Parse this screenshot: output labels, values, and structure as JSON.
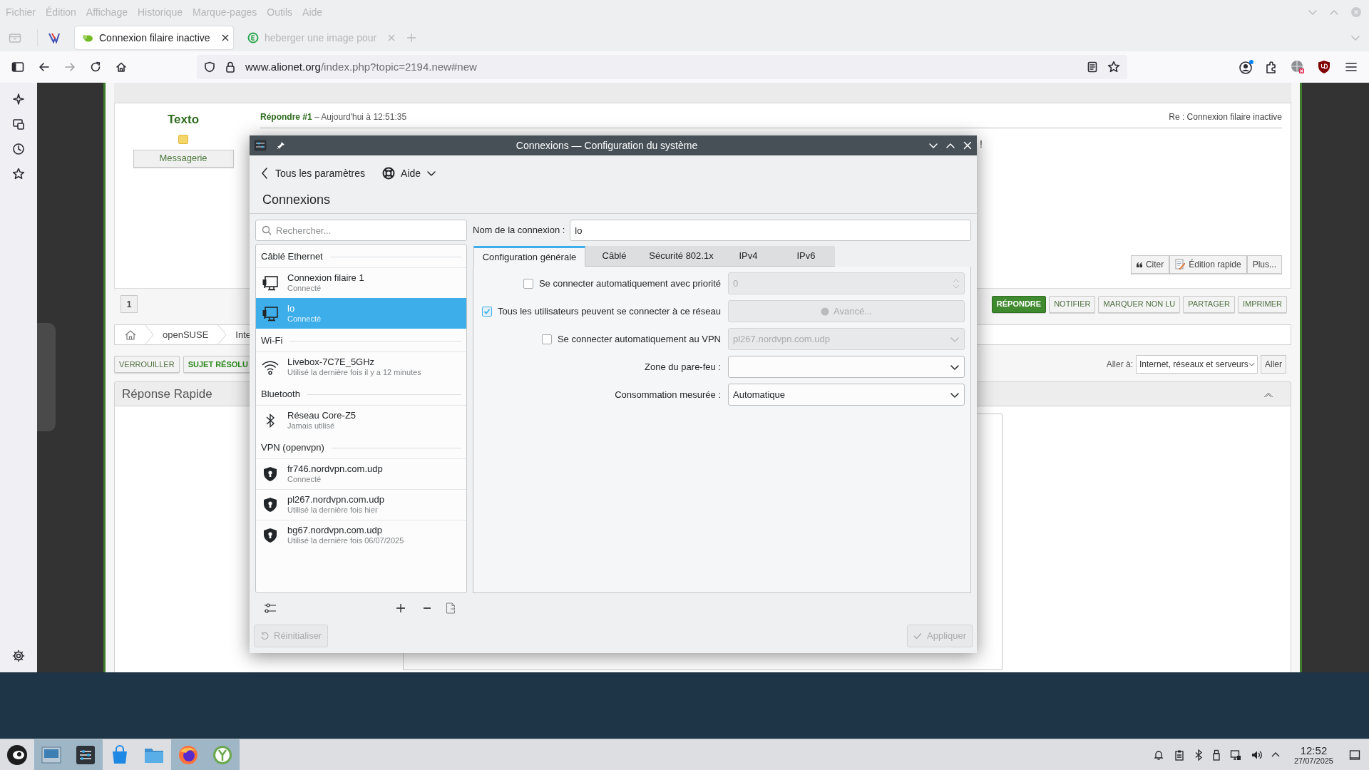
{
  "browser": {
    "menu": [
      "Fichier",
      "Édition",
      "Affichage",
      "Historique",
      "Marque-pages",
      "Outils",
      "Aide"
    ],
    "tabs": [
      {
        "label": "Connexion filaire inactive",
        "selected": true
      },
      {
        "label": "heberger une image pour",
        "selected": false
      }
    ],
    "address": {
      "host": "www.alionet.org",
      "path": "/index.php?topic=2194.new#new"
    }
  },
  "forum": {
    "post": {
      "author": "Texto",
      "messaging_button": "Messagerie",
      "reply_ref": "Répondre #1",
      "time": "– Aujourd'hui à 12:51:35",
      "subject": "Re : Connexion filaire inactive",
      "body": "!",
      "actions": [
        "Citer",
        "Édition rapide",
        "Plus..."
      ]
    },
    "page": "1",
    "topic_buttons": [
      {
        "label": "RÉPONDRE",
        "kind": "primary"
      },
      {
        "label": "NOTIFIER",
        "kind": "default"
      },
      {
        "label": "MARQUER NON LU",
        "kind": "default"
      },
      {
        "label": "PARTAGER",
        "kind": "default"
      },
      {
        "label": "IMPRIMER",
        "kind": "default"
      }
    ],
    "breadcrumb": [
      "openSUSE",
      "Inte"
    ],
    "mod_buttons": [
      {
        "label": "VERROUILLER",
        "kind": "default"
      },
      {
        "label": "SUJET RÉSOLU",
        "kind": "primary"
      }
    ],
    "jump": {
      "label": "Aller à:",
      "value": "Internet, réseaux et serveurs",
      "button": "Aller"
    },
    "quick_reply": {
      "title": "Réponse Rapide"
    }
  },
  "dialog": {
    "title": "Connexions — Configuration du système",
    "back": "Tous les paramètres",
    "help": "Aide",
    "heading": "Connexions",
    "search": {
      "placeholder": "Rechercher..."
    },
    "groups": [
      {
        "title": "Câblé Ethernet",
        "connections": [
          {
            "kind": "ethernet",
            "name": "Connexion filaire 1",
            "status": "Connecté",
            "selected": false
          },
          {
            "kind": "ethernet",
            "name": "lo",
            "status": "Connecté",
            "selected": true
          }
        ]
      },
      {
        "title": "Wi-Fi",
        "connections": [
          {
            "kind": "wifi",
            "name": "Livebox-7C7E_5GHz",
            "status": "Utilisé la dernière fois il y a 12 minutes",
            "selected": false
          }
        ]
      },
      {
        "title": "Bluetooth",
        "connections": [
          {
            "kind": "bluetooth",
            "name": "Réseau Core-Z5",
            "status": "Jamais utilisé",
            "selected": false
          }
        ]
      },
      {
        "title": "VPN (openvpn)",
        "connections": [
          {
            "kind": "vpn",
            "name": "fr746.nordvpn.com.udp",
            "status": "Connecté",
            "selected": false
          },
          {
            "kind": "vpn",
            "name": "pl267.nordvpn.com.udp",
            "status": "Utilisé la dernière fois hier",
            "selected": false
          },
          {
            "kind": "vpn",
            "name": "bg67.nordvpn.com.udp",
            "status": "Utilisé la dernière fois 06/07/2025",
            "selected": false
          }
        ]
      }
    ],
    "name_label": "Nom de la connexion :",
    "name_value": "lo",
    "tabs": [
      {
        "label": "Configuration générale",
        "selected": true
      },
      {
        "label": "Câblé",
        "selected": false
      },
      {
        "label": "Sécurité 802.1x",
        "selected": false
      },
      {
        "label": "IPv4",
        "selected": false
      },
      {
        "label": "IPv6",
        "selected": false
      }
    ],
    "options": [
      {
        "kind": "checkbox-spin",
        "label": "Se connecter automatiquement avec priorité",
        "checked": false,
        "value": "0",
        "disabled": true
      },
      {
        "kind": "checkbox-button",
        "label": "Tous les utilisateurs peuvent se connecter à ce réseau",
        "checked": true,
        "button": "Avancé...",
        "disabled": true
      },
      {
        "kind": "checkbox-select",
        "label": "Se connecter automatiquement au VPN",
        "checked": false,
        "value": "pl267.nordvpn.com.udp",
        "disabled": true
      },
      {
        "kind": "select",
        "label": "Zone du pare-feu :",
        "disabled": false
      },
      {
        "kind": "select",
        "label": "Consommation mesurée :",
        "value": "Automatique",
        "disabled": false
      }
    ],
    "reset": "Réinitialiser",
    "apply": "Appliquer"
  },
  "taskbar": {
    "time": "12:52",
    "date": "27/07/2025"
  }
}
